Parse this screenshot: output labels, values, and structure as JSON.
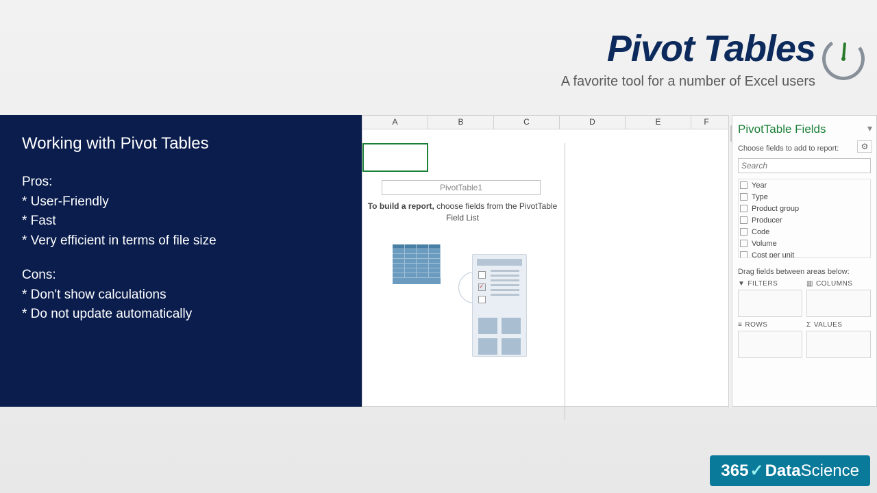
{
  "header": {
    "title": "Pivot Tables",
    "subtitle": "A favorite tool for a number of Excel users"
  },
  "panel": {
    "heading": "Working with Pivot Tables",
    "pros_label": "Pros:",
    "pros": [
      "* User-Friendly",
      "* Fast",
      "* Very efficient in terms of file size"
    ],
    "cons_label": "Cons:",
    "cons": [
      "* Don't show calculations",
      "* Do not update automatically"
    ]
  },
  "excel": {
    "columns": [
      "A",
      "B",
      "C",
      "D",
      "E",
      "F"
    ],
    "pivot_name": "PivotTable1",
    "hint_prefix": "To build a report, ",
    "hint_rest": "choose fields from the PivotTable Field List"
  },
  "fieldpane": {
    "title": "PivotTable Fields",
    "subtitle": "Choose fields to add to report:",
    "search_placeholder": "Search",
    "fields": [
      "Year",
      "Type",
      "Product group",
      "Producer",
      "Code",
      "Volume",
      "Cost per unit"
    ],
    "drag_label": "Drag fields between areas below:",
    "areas": {
      "filters": "FILTERS",
      "columns": "COLUMNS",
      "rows": "ROWS",
      "values": "VALUES"
    }
  },
  "logo": {
    "brand_num": "365",
    "brand_a": "Data",
    "brand_b": "Science"
  }
}
